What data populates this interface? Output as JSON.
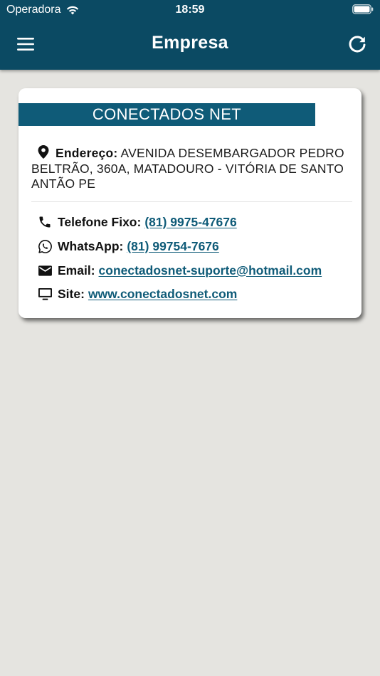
{
  "status_bar": {
    "carrier": "Operadora",
    "time": "18:59"
  },
  "app_bar": {
    "title": "Empresa",
    "background_color": "#0b4a63",
    "menu_icon": "hamburger-menu-icon",
    "refresh_icon": "refresh-icon"
  },
  "company": {
    "name": "CONECTADOS NET",
    "banner_color": "#0f5b78",
    "address": {
      "label": "Endereço:",
      "value": "AVENIDA DESEMBARGADOR PEDRO BELTRÃO, 360A, MATADOURO - VITÓRIA DE SANTO ANTÃO PE",
      "icon": "location-pin-icon"
    },
    "contacts": {
      "phone": {
        "label": "Telefone Fixo:",
        "value": "(81) 9975-47676",
        "icon": "phone-icon"
      },
      "whatsapp": {
        "label": "WhatsApp:",
        "value": "(81) 99754-7676",
        "icon": "whatsapp-icon"
      },
      "email": {
        "label": "Email:",
        "value": "conectadosnet-suporte@hotmail.com",
        "icon": "mail-icon"
      },
      "site": {
        "label": "Site:",
        "value": "www.conectadosnet.com",
        "icon": "monitor-icon"
      }
    },
    "link_color": "#0f5b78"
  }
}
